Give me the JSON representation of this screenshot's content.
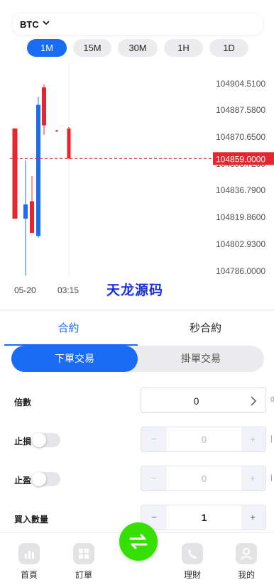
{
  "header": {
    "symbol": "BTC"
  },
  "timeframes": [
    {
      "label": "1M",
      "active": true
    },
    {
      "label": "15M",
      "active": false
    },
    {
      "label": "30M",
      "active": false
    },
    {
      "label": "1H",
      "active": false
    },
    {
      "label": "1D",
      "active": false
    }
  ],
  "chart_data": {
    "type": "candlestick",
    "y_ticks": [
      "104904.5100",
      "104887.5800",
      "104870.6500",
      "104853.7200",
      "104836.7900",
      "104819.8600",
      "104802.9300",
      "104786.0000"
    ],
    "x_ticks": [
      "05-20",
      "03:15"
    ],
    "current_price": "104859.0000",
    "ylim": [
      104786.0,
      104904.51
    ],
    "candles": [
      {
        "open": 104878.0,
        "close": 104821.0,
        "high": 104878.0,
        "low": 104821.0,
        "color": "#e8242d"
      },
      {
        "open": 104821.0,
        "close": 104830.0,
        "high": 104858.0,
        "low": 104785.0,
        "color": "#1a6cf5"
      },
      {
        "open": 104832.0,
        "close": 104812.0,
        "high": 104848.0,
        "low": 104812.0,
        "color": "#e8242d"
      },
      {
        "open": 104810.0,
        "close": 104893.0,
        "high": 104898.0,
        "low": 104809.0,
        "color": "#1a6cf5"
      },
      {
        "open": 104904.0,
        "close": 104880.0,
        "high": 104906.0,
        "low": 104874.0,
        "color": "#e8242d"
      },
      {
        "open": 104877.0,
        "close": 104876.0,
        "high": 104877.0,
        "low": 104876.0,
        "color": "#e8242d"
      },
      {
        "open": 104878.0,
        "close": 104859.0,
        "high": 104879.0,
        "low": 104859.0,
        "color": "#e8242d"
      }
    ],
    "colors": {
      "up": "#1a6cf5",
      "down": "#e8242d",
      "price_line": "#e8242d"
    }
  },
  "watermark": "天龙源码",
  "tabs": [
    {
      "label": "合約",
      "active": true
    },
    {
      "label": "秒合約",
      "active": false
    }
  ],
  "order_type": {
    "market": "下單交易",
    "limit": "掛單交易"
  },
  "form": {
    "leverage": {
      "label": "倍數",
      "value": "0"
    },
    "stop_loss": {
      "label": "止損",
      "value": "0",
      "minus": "−",
      "plus": "+"
    },
    "take_profit": {
      "label": "止盈",
      "value": "0",
      "minus": "−",
      "plus": "+"
    },
    "quantity": {
      "label": "買入數量",
      "value": "1",
      "minus": "−",
      "plus": "+"
    }
  },
  "bottom_nav": [
    {
      "label": "首頁",
      "icon": "chart-icon"
    },
    {
      "label": "訂單",
      "icon": "grid-icon"
    },
    {
      "label": "理財",
      "icon": "phone-icon"
    },
    {
      "label": "我的",
      "icon": "user-icon"
    }
  ],
  "colors": {
    "accent": "#1a6cf5",
    "fab": "#35e000"
  }
}
